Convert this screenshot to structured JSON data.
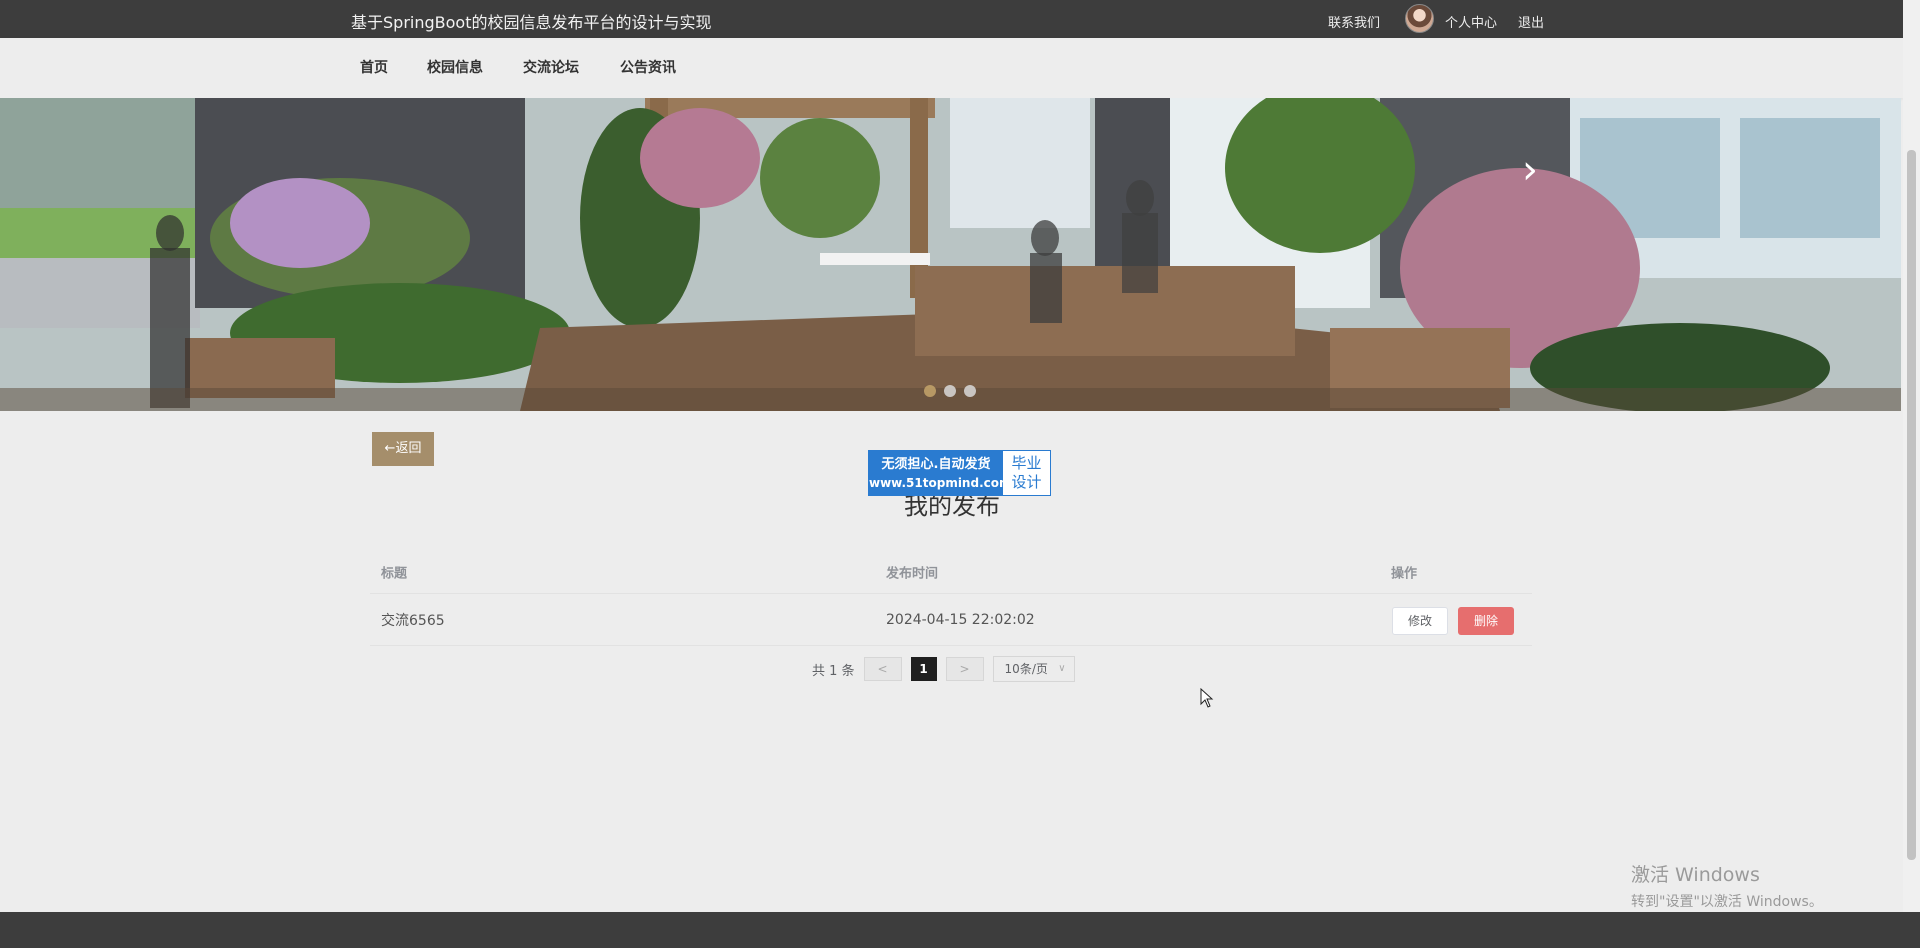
{
  "header": {
    "site_title": "基于SpringBoot的校园信息发布平台的设计与实现",
    "contact": "联系我们",
    "user_center": "个人中心",
    "logout": "退出"
  },
  "nav": {
    "items": [
      "首页",
      "校园信息",
      "交流论坛",
      "公告资讯"
    ]
  },
  "banner": {
    "next_icon": "chevron-right-icon",
    "dot_count": 3,
    "active_dot": 0
  },
  "content": {
    "back_label": "←返回",
    "title": "我的发布",
    "watermark": {
      "slogan": "无须担心.自动发货",
      "url": "www.51topmind.com",
      "tag_line1": "毕业",
      "tag_line2": "设计"
    }
  },
  "table": {
    "columns": [
      "标题",
      "发布时间",
      "操作"
    ],
    "rows": [
      {
        "title": "交流6565",
        "time": "2024-04-15 22:02:02",
        "edit": "修改",
        "delete": "删除"
      }
    ]
  },
  "pagination": {
    "total": "共 1 条",
    "prev": "<",
    "current": "1",
    "next": ">",
    "page_size": "10条/页"
  },
  "os_notice": {
    "line1": "激活 Windows",
    "line2": "转到\"设置\"以激活 Windows。"
  },
  "colors": {
    "topbar": "#3d3d3d",
    "accent": "#a58e6b",
    "danger": "#e66e6e"
  }
}
